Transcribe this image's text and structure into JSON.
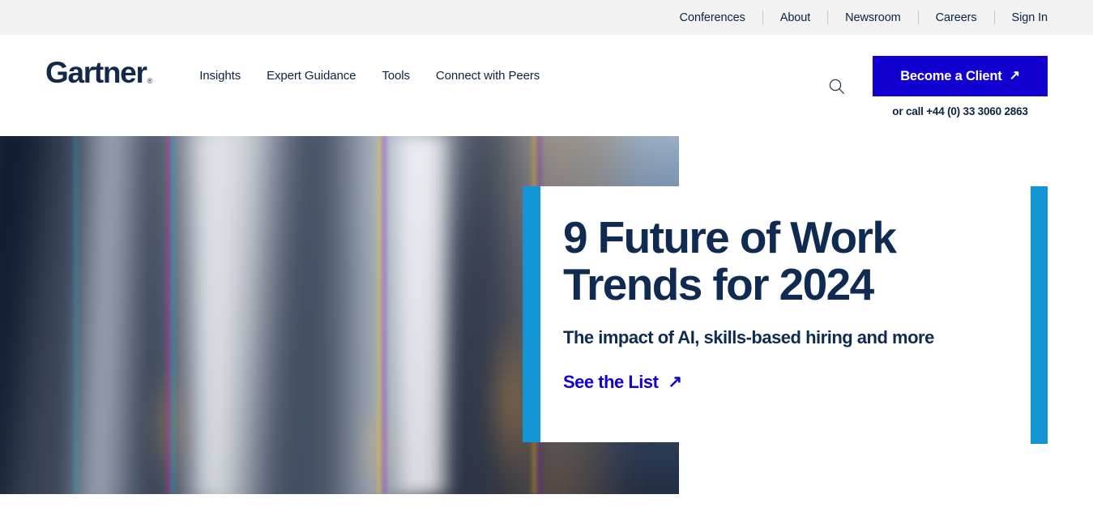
{
  "utility_bar": {
    "items": [
      {
        "label": "Conferences"
      },
      {
        "label": "About"
      },
      {
        "label": "Newsroom"
      },
      {
        "label": "Careers"
      },
      {
        "label": "Sign In"
      }
    ]
  },
  "header": {
    "logo": {
      "text": "Gartner",
      "trademark": "®",
      "icon": "gartner-logo"
    },
    "nav": [
      {
        "label": "Insights"
      },
      {
        "label": "Expert Guidance"
      },
      {
        "label": "Tools"
      },
      {
        "label": "Connect with Peers"
      }
    ],
    "search": {
      "icon": "search-icon"
    },
    "cta": {
      "label": "Become a Client",
      "arrow": "↗",
      "phone": "or call +44 (0) 33 3060 2863",
      "background": "#1200d3"
    }
  },
  "hero": {
    "title": "9 Future of Work Trends for 2024",
    "subtitle": "The impact of AI, skills-based hiring and more",
    "link": {
      "label": "See the List",
      "arrow": "↗",
      "color": "#1200d3"
    },
    "accent_color": "#1394d5",
    "title_color": "#0f2b52",
    "image": {
      "alt": "blurred-crowd-of-people-walking"
    }
  }
}
